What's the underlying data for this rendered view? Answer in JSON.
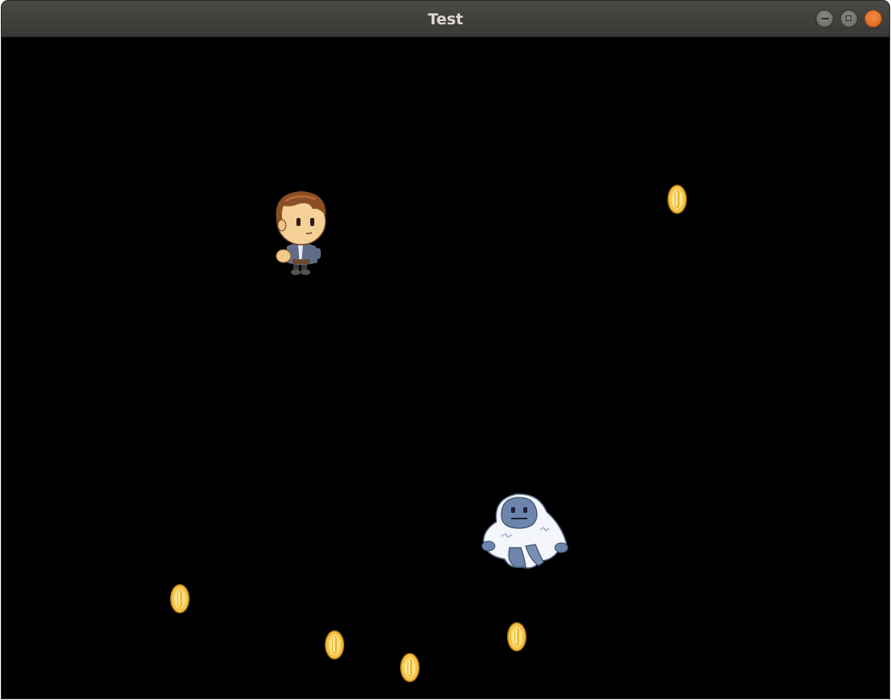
{
  "window": {
    "title": "Test",
    "controls": [
      "minimize",
      "maximize",
      "close"
    ],
    "close_color": "#e9692a"
  },
  "scene": {
    "background": "#000000",
    "player": {
      "sprite": "boy-character"
    },
    "enemy": {
      "sprite": "yeti-character"
    },
    "coins": [
      {
        "sprite": "gold-coin"
      },
      {
        "sprite": "gold-coin"
      },
      {
        "sprite": "gold-coin"
      },
      {
        "sprite": "gold-coin"
      },
      {
        "sprite": "gold-coin"
      }
    ],
    "coin_color": "#f5c341"
  }
}
